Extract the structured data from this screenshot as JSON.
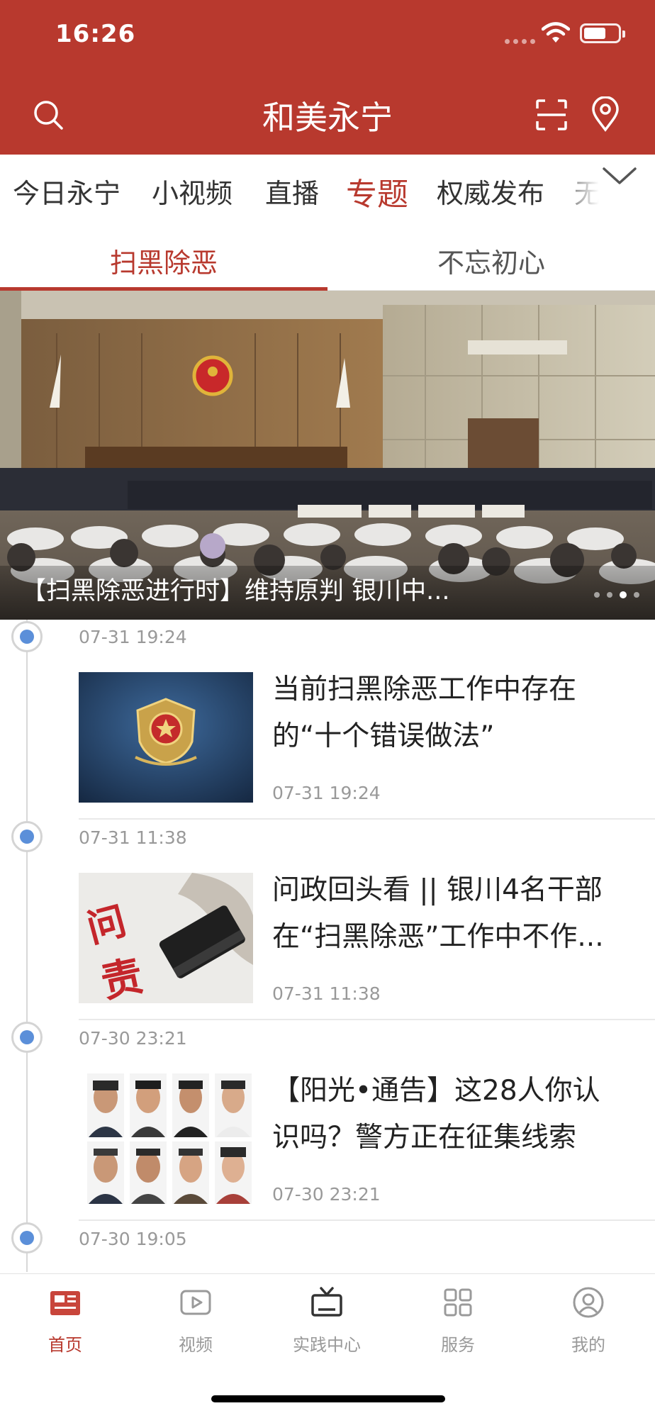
{
  "status_bar": {
    "time": "16:26"
  },
  "header": {
    "title": "和美永宁",
    "search_icon": "search-icon",
    "scan_icon": "scan-icon",
    "location_icon": "location-pin-icon"
  },
  "channels": {
    "items": [
      {
        "label": "今日永宁"
      },
      {
        "label": "小视频"
      },
      {
        "label": "直播"
      },
      {
        "label": "专题"
      },
      {
        "label": "权威发布"
      },
      {
        "label": "无"
      }
    ],
    "active": "专题",
    "expand_icon": "chevron-down-icon"
  },
  "sub_tabs": {
    "items": [
      {
        "label": "扫黑除恶"
      },
      {
        "label": "不忘初心"
      }
    ],
    "active": "扫黑除恶"
  },
  "banner": {
    "caption": "【扫黑除恶进行时】维持原判 银川中...",
    "dot_count": 4,
    "active_dot": 3
  },
  "timeline": [
    {
      "time": "07-31 19:24",
      "title": "当前扫黑除恶工作中存在的“十个错误做法”",
      "title_line1": "当前扫黑除恶工作中存在",
      "title_line2": "的“十个错误做法”",
      "date": "07-31 19:24"
    },
    {
      "time": "07-31 11:38",
      "title": "问政回头看 || 银川4名干部在“扫黑除恶”工作中不作...",
      "title_line1": "问政回头看 || 银川4名干部",
      "title_line2": "在“扫黑除恶”工作中不作...",
      "date": "07-31 11:38",
      "thumb_text": "问责"
    },
    {
      "time": "07-30 23:21",
      "title": "【阳光•通告】这28人你认识吗？警方正在征集线索",
      "title_line1": "【阳光•通告】这28人你认",
      "title_line2": "识吗？警方正在征集线索",
      "date": "07-30 23:21"
    },
    {
      "time": "07-30 19:05"
    }
  ],
  "bottom_nav": [
    {
      "label": "首页",
      "icon": "newspaper-icon",
      "active": true
    },
    {
      "label": "视频",
      "icon": "play-icon"
    },
    {
      "label": "实践中心",
      "icon": "tv-icon"
    },
    {
      "label": "服务",
      "icon": "grid-icon"
    },
    {
      "label": "我的",
      "icon": "user-icon"
    }
  ],
  "colors": {
    "brand": "#b8392e",
    "timeline_dot": "#5b8fd9"
  }
}
